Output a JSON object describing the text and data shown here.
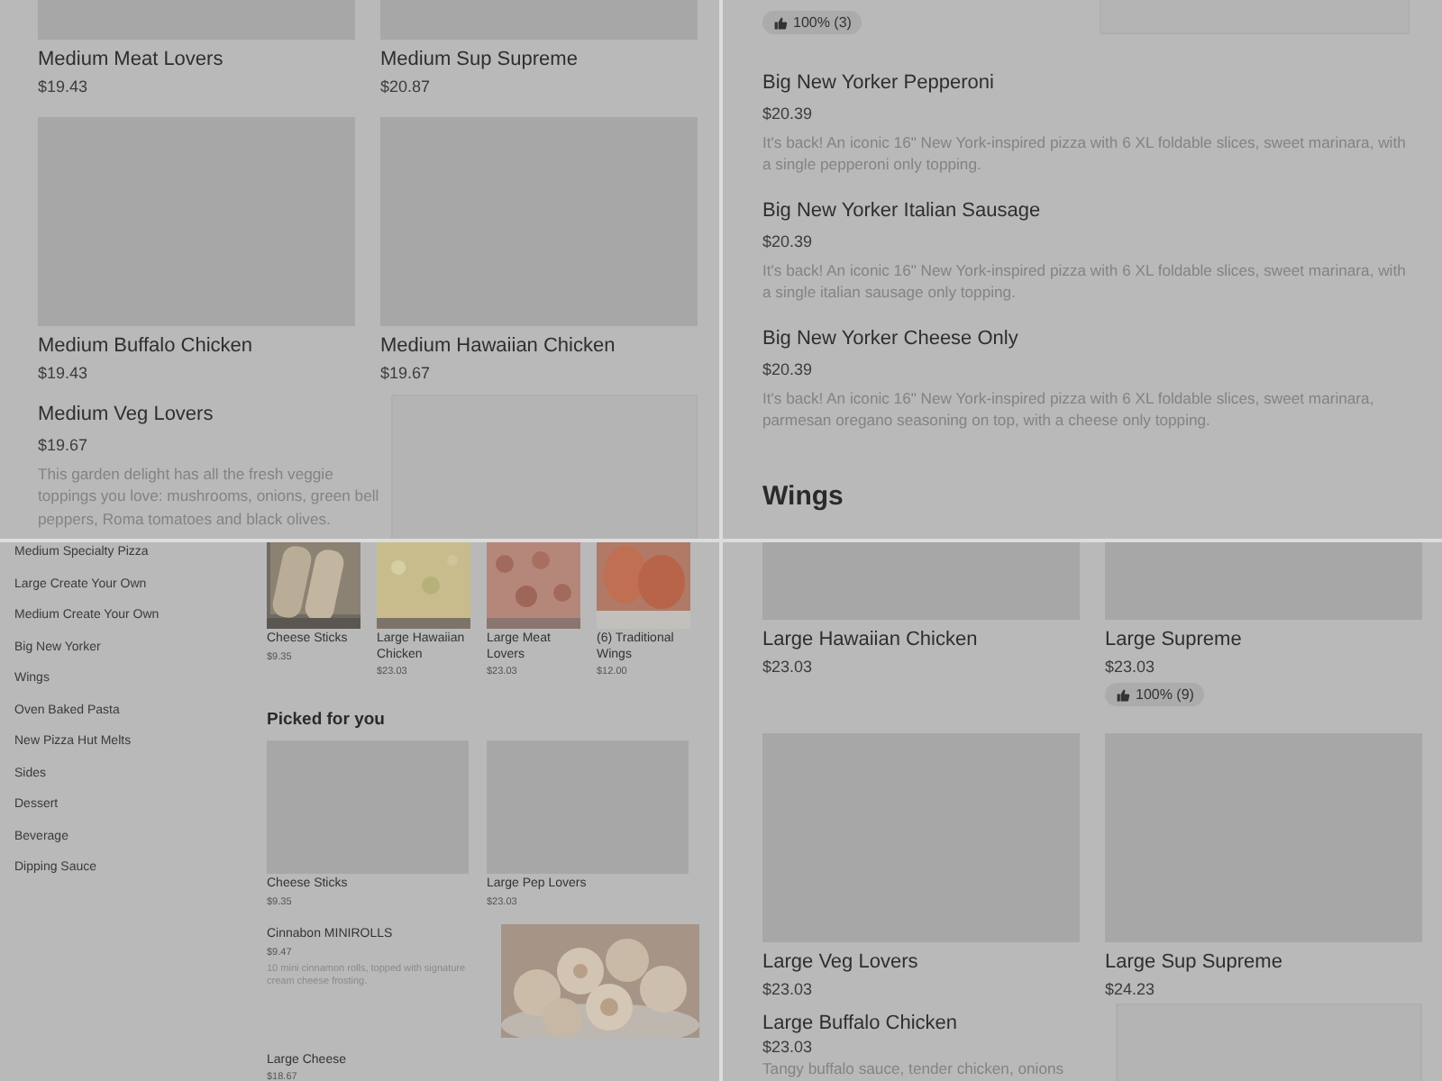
{
  "top_left": {
    "items": [
      {
        "name": "Medium Meat Lovers",
        "price": "$19.43"
      },
      {
        "name": "Medium Sup Supreme",
        "price": "$20.87"
      },
      {
        "name": "Medium Buffalo Chicken",
        "price": "$19.43"
      },
      {
        "name": "Medium Hawaiian Chicken",
        "price": "$19.67"
      }
    ],
    "featured": {
      "name": "Medium Veg Lovers",
      "price": "$19.67",
      "description": "This garden delight has all the fresh veggie toppings you love: mushrooms, onions, green bell peppers, Roma tomatoes and black olives."
    }
  },
  "top_right": {
    "rating": "100% (3)",
    "items": [
      {
        "name": "Big New Yorker Pepperoni",
        "price": "$20.39",
        "description": "It's back! An iconic 16\" New York-inspired pizza with 6 XL foldable slices, sweet marinara, with a single pepperoni only topping."
      },
      {
        "name": "Big New Yorker Italian Sausage",
        "price": "$20.39",
        "description": "It's back! An iconic 16\" New York-inspired pizza with 6 XL foldable slices, sweet marinara, with a single italian sausage only topping."
      },
      {
        "name": "Big New Yorker Cheese Only",
        "price": "$20.39",
        "description": "It's back! An iconic 16\" New York-inspired pizza with 6 XL foldable slices, sweet marinara, parmesan oregano seasoning on top, with a cheese only topping."
      }
    ],
    "section_title": "Wings"
  },
  "bottom_left": {
    "categories": [
      "Medium Specialty Pizza",
      "Large Create Your Own",
      "Medium Create Your Own",
      "Big New Yorker",
      "Wings",
      "Oven Baked Pasta",
      "New Pizza Hut Melts",
      "Sides",
      "Dessert",
      "Beverage",
      "Dipping Sauce"
    ],
    "carousel": [
      {
        "name": "Cheese Sticks",
        "price": "$9.35",
        "kind": "picture"
      },
      {
        "name": "Large Hawaiian Chicken",
        "price": "$23.03",
        "kind": "picture"
      },
      {
        "name": "Large Meat Lovers",
        "price": "$23.03",
        "kind": "picture"
      },
      {
        "name": "(6) Traditional Wings",
        "price": "$12.00",
        "kind": "picture"
      }
    ],
    "picked_title": "Picked for you",
    "picked": [
      {
        "name": "Cheese Sticks",
        "price": "$9.35"
      },
      {
        "name": "Large Pep Lovers",
        "price": "$23.03"
      }
    ],
    "promo": {
      "name": "Cinnabon MINIROLLS",
      "price": "$9.47",
      "description": "10 mini cinnamon rolls, topped with signature cream cheese frosting.",
      "kind": "picture"
    },
    "last": {
      "name": "Large Cheese",
      "price": "$18.67"
    }
  },
  "bottom_right": {
    "items": [
      {
        "name": "Large Hawaiian Chicken",
        "price": "$23.03"
      },
      {
        "name": "Large Supreme",
        "price": "$23.03",
        "rating": "100% (9)"
      },
      {
        "name": "Large Veg Lovers",
        "price": "$23.03"
      },
      {
        "name": "Large Sup Supreme",
        "price": "$24.23"
      }
    ],
    "featured": {
      "name": "Large Buffalo Chicken",
      "price": "$23.03",
      "description": "Tangy buffalo sauce, tender chicken, onions"
    }
  }
}
